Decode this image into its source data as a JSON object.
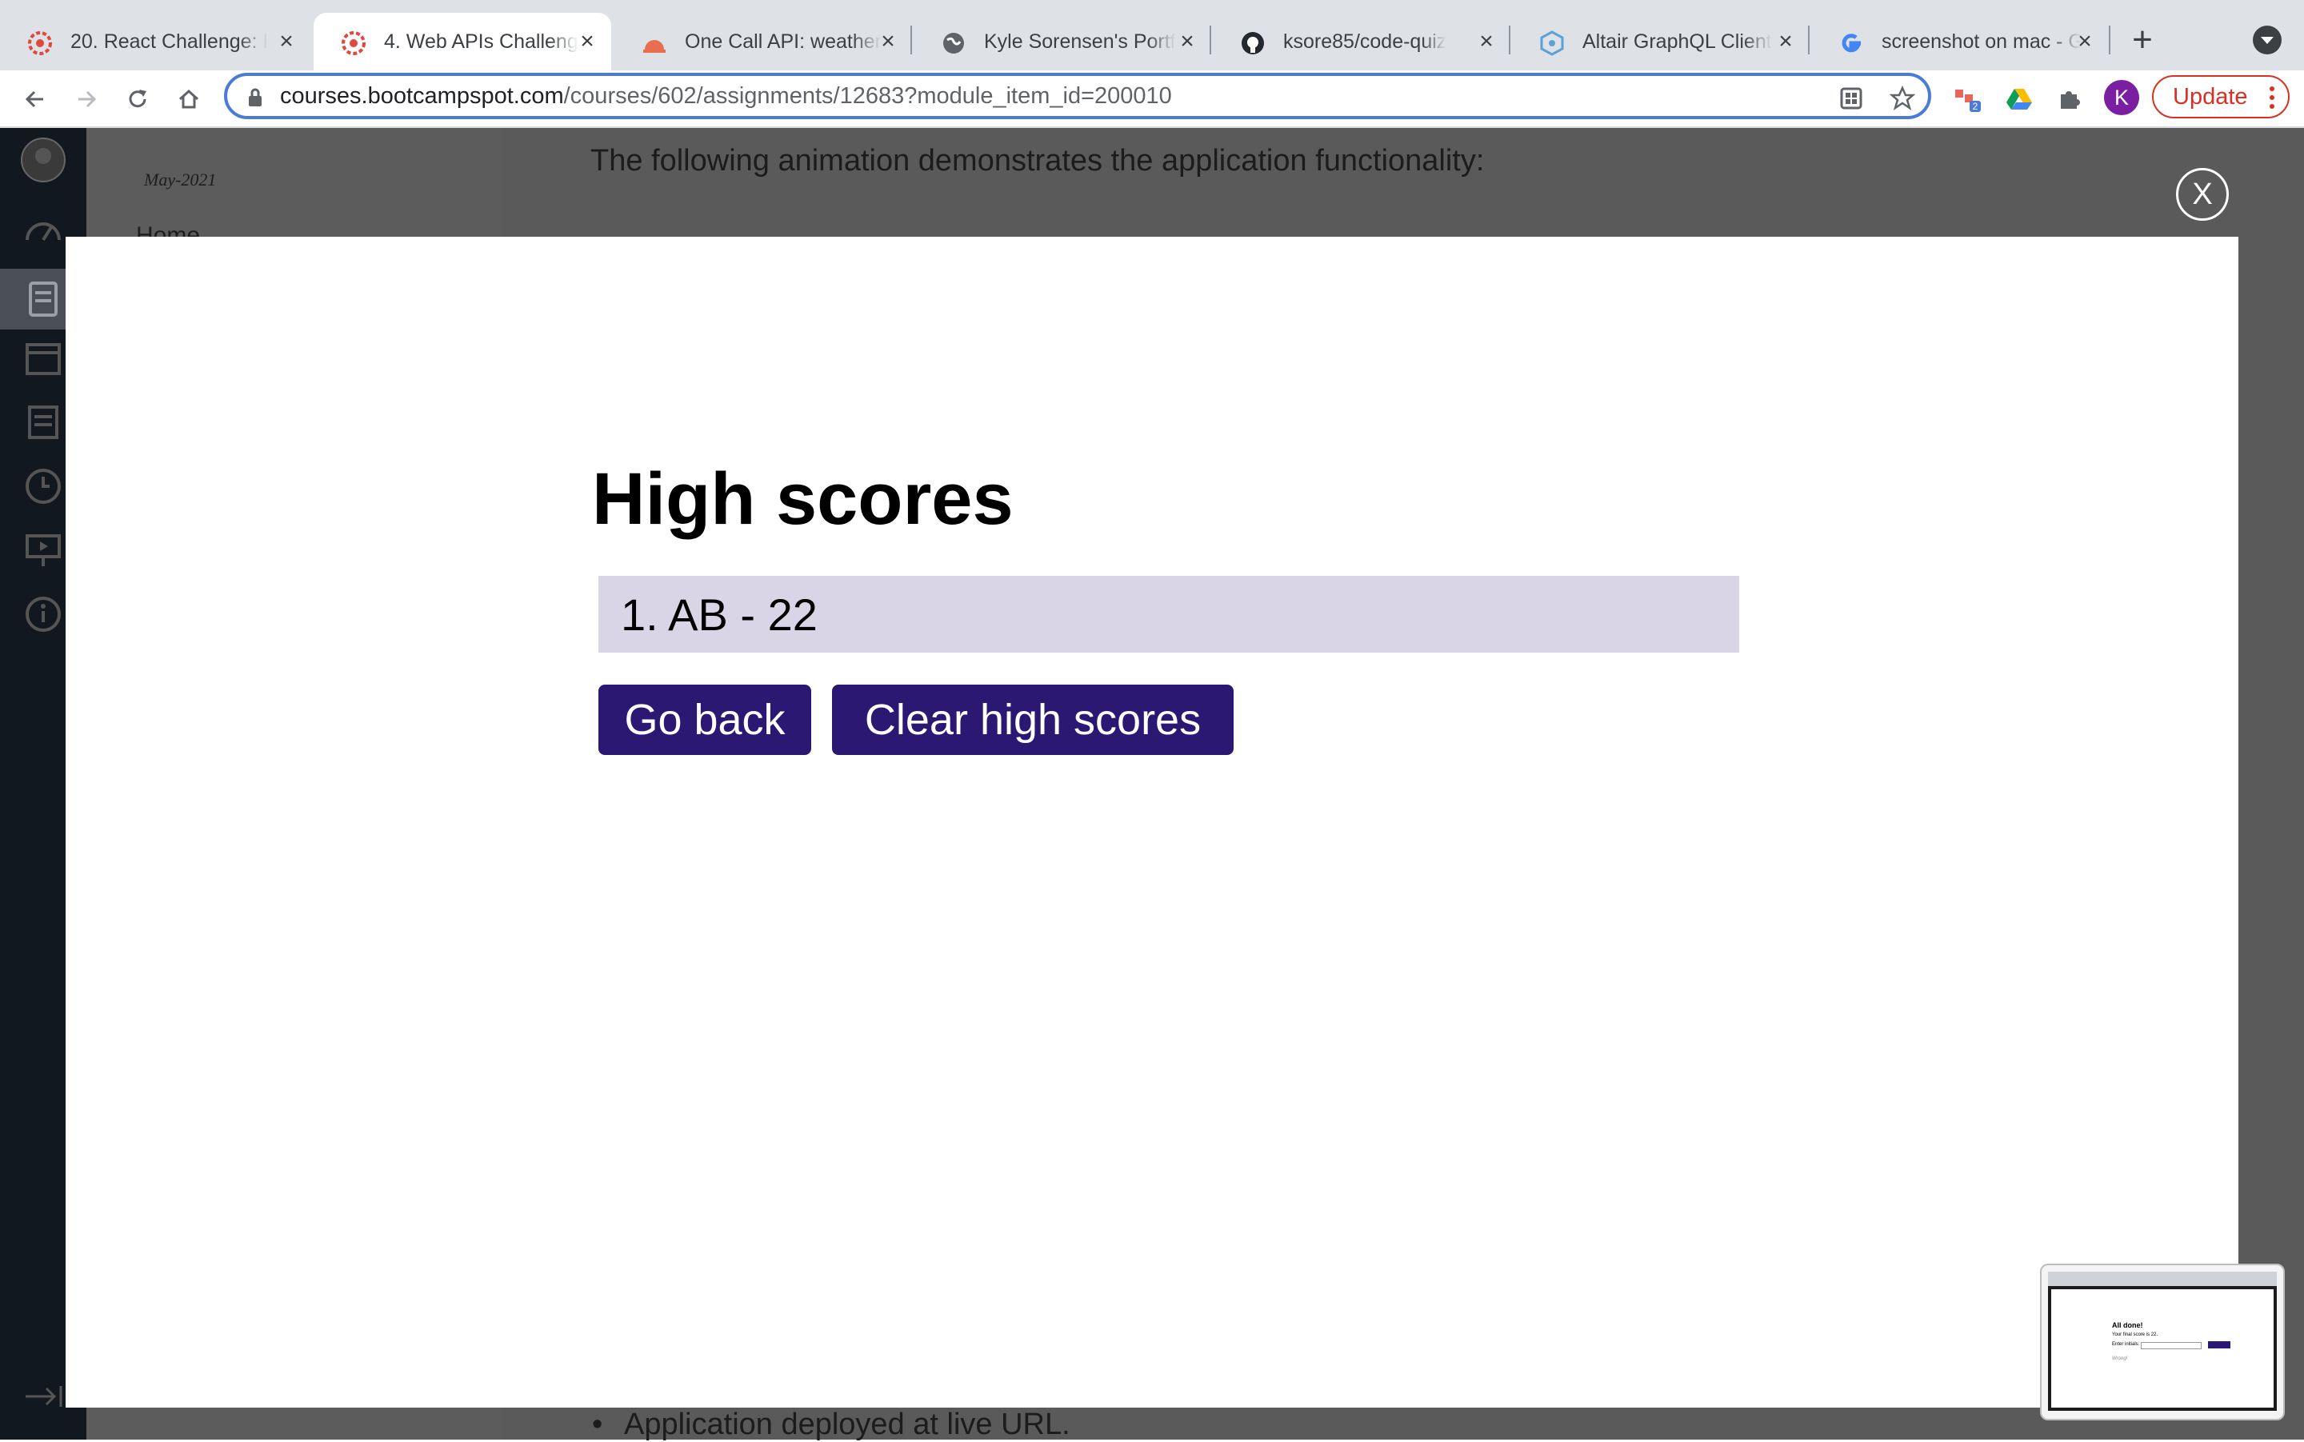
{
  "browser": {
    "tabs": [
      {
        "title": "20. React Challenge: I",
        "favicon": "bootcamp-icon"
      },
      {
        "title": "4. Web APIs Challeng",
        "favicon": "bootcamp-icon"
      },
      {
        "title": "One Call API: weather",
        "favicon": "openweather-icon"
      },
      {
        "title": "Kyle Sorensen's Portf",
        "favicon": "globe-icon"
      },
      {
        "title": "ksore85/code-quiz",
        "favicon": "github-icon"
      },
      {
        "title": "Altair GraphQL Client",
        "favicon": "altair-icon"
      },
      {
        "title": "screenshot on mac - G",
        "favicon": "google-icon"
      }
    ],
    "active_tab": 1,
    "url_host": "courses.bootcampspot.com",
    "url_path": "/courses/602/assignments/12683?module_item_id=200010",
    "profile_initial": "K",
    "update_label": "Update",
    "extension_badge": "2"
  },
  "page": {
    "course_date": "May-2021",
    "course_home": "Home",
    "intro_text": "The following animation demonstrates the application functionality:",
    "bullet_text": "Application deployed at live URL."
  },
  "modal": {
    "close_label": "X",
    "heading": "High scores",
    "scores": [
      "1. AB - 22"
    ],
    "go_back_label": "Go back",
    "clear_label": "Clear high scores"
  },
  "thumbnail": {
    "title": "All done!",
    "line1": "Your final score is 22.",
    "line2": "Enter initials:",
    "line3": "Wrong!"
  },
  "colors": {
    "button_bg": "#2b1873",
    "score_row_bg": "#d9d5e7",
    "update_red": "#d93025",
    "omnibox_focus": "#4a7bd8"
  }
}
